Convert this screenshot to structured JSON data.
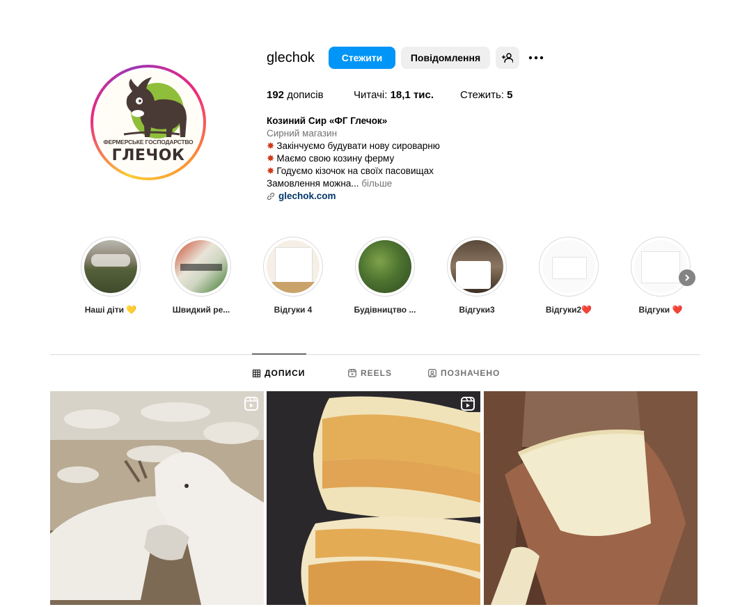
{
  "profile": {
    "username": "glechok",
    "follow_label": "Стежити",
    "message_label": "Повідомлення",
    "avatar_small_text": "ФЕРМЕРСЬКЕ ГОСПОДАРСТВО",
    "avatar_big_text": "ГЛЕЧОК"
  },
  "stats": {
    "posts_value": "192",
    "posts_label": " дописів",
    "followers_label": "Читачі: ",
    "followers_value": "18,1 тис.",
    "following_label": "Стежить: ",
    "following_value": "5"
  },
  "bio": {
    "name": "Козиний Сир «ФГ Глечок»",
    "category": "Сирний магазин",
    "lines": [
      "Закінчуємо будувати нову сироварню",
      "Маємо свою козину ферму",
      "Годуємо кізочок на своїх пасовищах"
    ],
    "truncated": "Замовлення можна...",
    "more_label": " більше",
    "link": "glechok.com"
  },
  "highlights": [
    {
      "label": "Наші діти 💛"
    },
    {
      "label": "Швидкий ре..."
    },
    {
      "label": "Відгуки 4"
    },
    {
      "label": "Будівництво ..."
    },
    {
      "label": "Відгуки3"
    },
    {
      "label": "Відгуки2❤️"
    },
    {
      "label": "Відгуки ❤️"
    }
  ],
  "tabs": [
    {
      "label": "ДОПИСИ",
      "active": true
    },
    {
      "label": "REELS",
      "active": false
    },
    {
      "label": "ПОЗНАЧЕНО",
      "active": false
    }
  ],
  "colors": {
    "accent": "#0095f6",
    "link": "#00376b",
    "muted": "#737373"
  },
  "icons": [
    "add-person-icon",
    "more-options-icon",
    "link-icon",
    "grid-icon",
    "reels-icon",
    "tagged-icon",
    "chevron-right-icon"
  ]
}
